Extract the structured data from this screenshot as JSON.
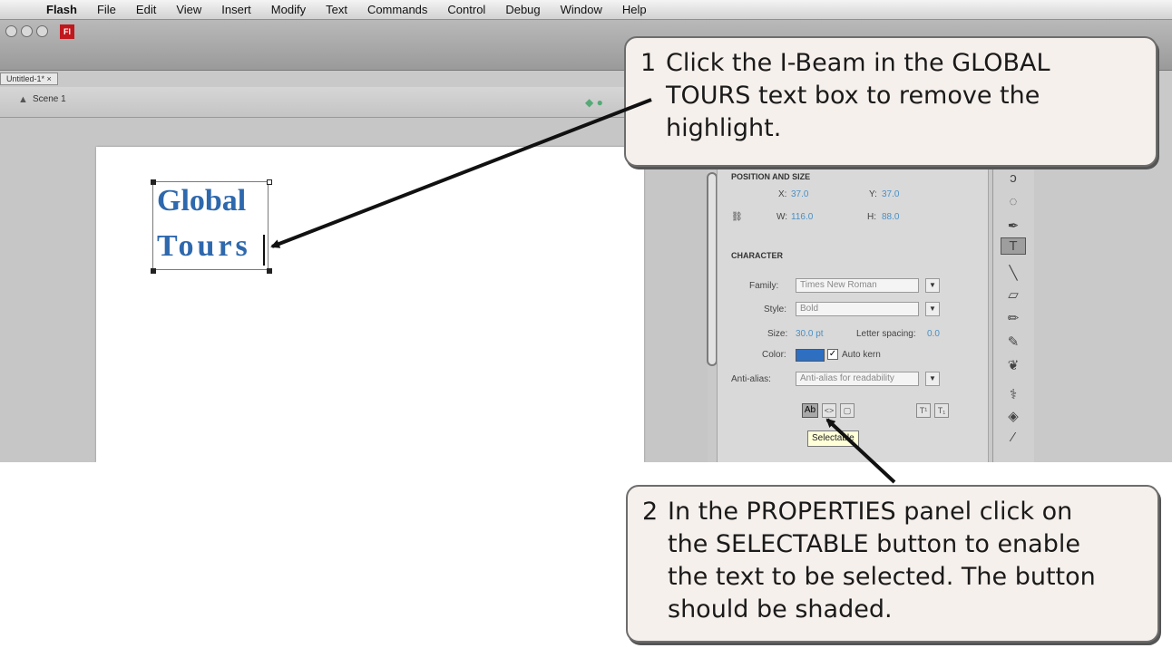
{
  "menubar": {
    "items": [
      "Flash",
      "File",
      "Edit",
      "View",
      "Insert",
      "Modify",
      "Text",
      "Commands",
      "Control",
      "Debug",
      "Window",
      "Help"
    ]
  },
  "window": {
    "badge": "Fl",
    "doc_tab": "Untitled-1* ×",
    "scene_label": "Scene 1"
  },
  "stage": {
    "text_line1": "Global",
    "text_line2": "Tours",
    "text_color": "#2e68ad"
  },
  "properties": {
    "position_header": "POSITION AND SIZE",
    "x_label": "X:",
    "x_value": "37.0",
    "y_label": "Y:",
    "y_value": "37.0",
    "w_label": "W:",
    "w_value": "116.0",
    "h_label": "H:",
    "h_value": "88.0",
    "character_header": "CHARACTER",
    "family_label": "Family:",
    "family_value": "Times New Roman",
    "style_label": "Style:",
    "style_value": "Bold",
    "size_label": "Size:",
    "size_value": "30.0 pt",
    "letter_spacing_label": "Letter spacing:",
    "letter_spacing_value": "0.0",
    "color_label": "Color:",
    "color_value": "#2f6fc2",
    "auto_kern_label": "Auto kern",
    "anti_alias_label": "Anti-alias:",
    "anti_alias_value": "Anti-alias for readability",
    "tooltip": "Selectable"
  },
  "callouts": {
    "c1": {
      "number": "1",
      "lines": [
        "Click the I-Beam in the GLOBAL",
        "TOURS text box to remove the",
        "highlight."
      ]
    },
    "c2": {
      "number": "2",
      "lines": [
        "In the PROPERTIES panel click on",
        "the SELECTABLE button to enable",
        "the text to be selected.  The button",
        "should be shaded."
      ]
    }
  }
}
